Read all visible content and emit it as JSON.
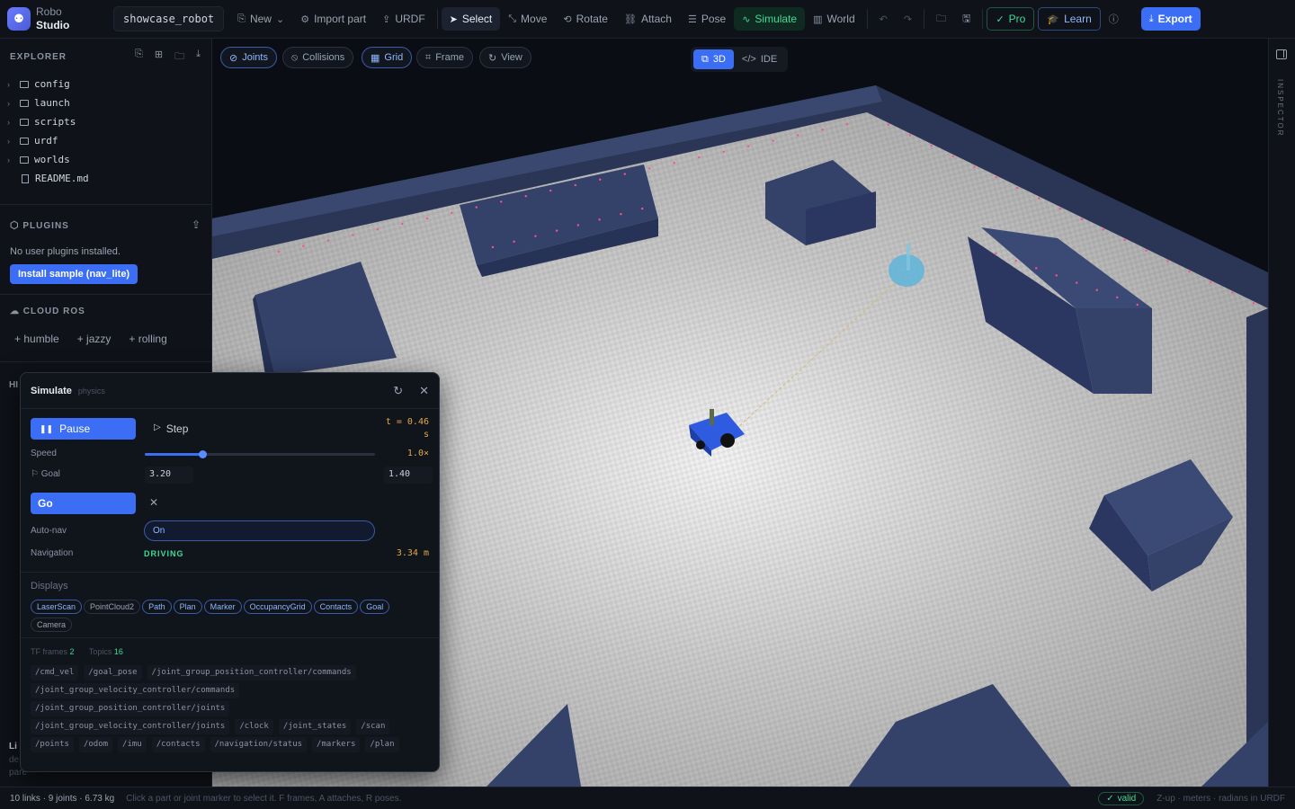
{
  "app": {
    "brand_top": "Robo",
    "brand_bottom": "Studio",
    "project": "showcase_robot"
  },
  "toolbar": {
    "new": "New",
    "import": "Import part",
    "urdf": "URDF",
    "select": "Select",
    "move": "Move",
    "rotate": "Rotate",
    "attach": "Attach",
    "pose": "Pose",
    "simulate": "Simulate",
    "world": "World",
    "pro": "Pro",
    "learn": "Learn",
    "export": "Export"
  },
  "explorer": {
    "title": "EXPLORER",
    "items": [
      "config",
      "launch",
      "scripts",
      "urdf",
      "worlds"
    ],
    "file": "README.md"
  },
  "plugins": {
    "title": "PLUGINS",
    "message": "No user plugins installed.",
    "install": "Install sample (nav_lite)"
  },
  "cloud_ros": {
    "title": "CLOUD ROS",
    "distros": [
      "+ humble",
      "+ jazzy",
      "+ rolling"
    ]
  },
  "sidebar_peek": {
    "h": "HI",
    "l": "Li",
    "d": "de",
    "p": "pare"
  },
  "viewport": {
    "pills": [
      "Joints",
      "Collisions",
      "Grid",
      "Frame",
      "View"
    ],
    "mode_3d": "3D",
    "mode_ide": "IDE"
  },
  "inspector": {
    "label": "INSPECTOR"
  },
  "simulate": {
    "title": "Simulate",
    "subtitle": "physics",
    "pause": "Pause",
    "step": "Step",
    "time": "t = 0.46",
    "time_unit": "s",
    "speed_label": "Speed",
    "speed_value": "1.0×",
    "speed_fraction": 0.25,
    "goal_label": "Goal",
    "goal_x": "3.20",
    "goal_y": "1.40",
    "go": "Go",
    "autonav_label": "Auto-nav",
    "autonav_value": "On",
    "nav_label": "Navigation",
    "nav_state": "DRIVING",
    "nav_dist": "3.34 m",
    "displays_title": "Displays",
    "displays": [
      "LaserScan",
      "PointCloud2",
      "Path",
      "Plan",
      "Marker",
      "OccupancyGrid",
      "Contacts",
      "Goal",
      "Camera"
    ],
    "tf_label": "TF frames",
    "tf_count": "2",
    "topics_label": "Topics",
    "topics_count": "16",
    "topics": [
      "/cmd_vel",
      "/goal_pose",
      "/joint_group_position_controller/commands",
      "/joint_group_velocity_controller/commands",
      "/joint_group_position_controller/joints",
      "/joint_group_velocity_controller/joints",
      "/clock",
      "/joint_states",
      "/scan",
      "/points",
      "/odom",
      "/imu",
      "/contacts",
      "/navigation/status",
      "/markers",
      "/plan"
    ]
  },
  "status": {
    "stats": "10 links · 9 joints · 6.73 kg",
    "hint": "Click a part or joint marker to select it. F frames, A attaches, R poses.",
    "valid": "valid",
    "units": "Z-up · meters · radians in URDF"
  },
  "colors": {
    "accent": "#3b6ef5",
    "sim": "#3ddc97",
    "amber": "#e0a94a"
  }
}
